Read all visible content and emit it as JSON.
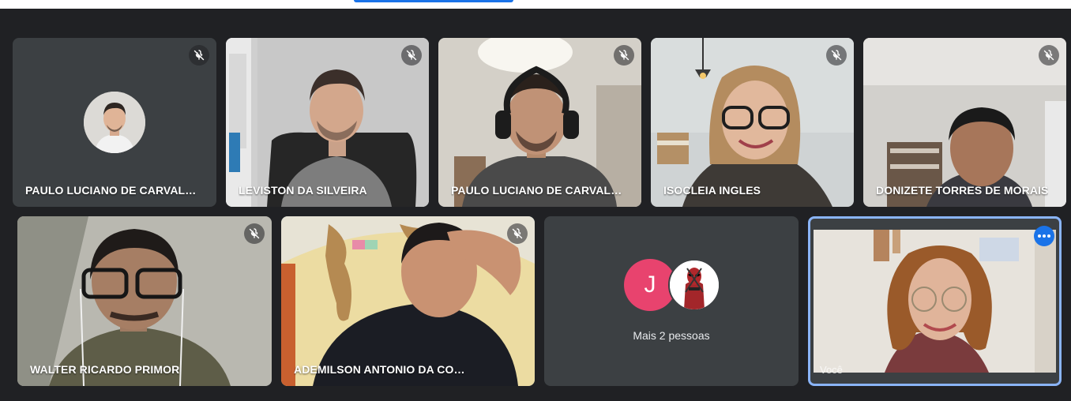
{
  "participants": [
    {
      "name": "PAULO LUCIANO DE CARVALH...",
      "muted": true,
      "video": false
    },
    {
      "name": "LEVISTON DA SILVEIRA",
      "muted": true,
      "video": true
    },
    {
      "name": "PAULO LUCIANO DE CARVALH...",
      "muted": true,
      "video": true
    },
    {
      "name": "ISOCLEIA INGLES",
      "muted": true,
      "video": true
    },
    {
      "name": "DONIZETE TORRES DE MORAIS",
      "muted": true,
      "video": true
    },
    {
      "name": "WALTER RICARDO PRIMOR",
      "muted": true,
      "video": true
    },
    {
      "name": "ADEMILSON ANTONIO DA COSTA",
      "muted": true,
      "video": true
    }
  ],
  "overflow": {
    "label": "Mais 2 pessoas",
    "avatar_initial": "J",
    "avatar_color": "#e8436e"
  },
  "self": {
    "label": "Você"
  },
  "colors": {
    "background": "#202124",
    "tile": "#3c4043",
    "accent": "#1a73e8",
    "self_border": "#8ab4f8"
  },
  "icons": {
    "muted": "mic-off-icon",
    "more": "more-options-icon"
  }
}
